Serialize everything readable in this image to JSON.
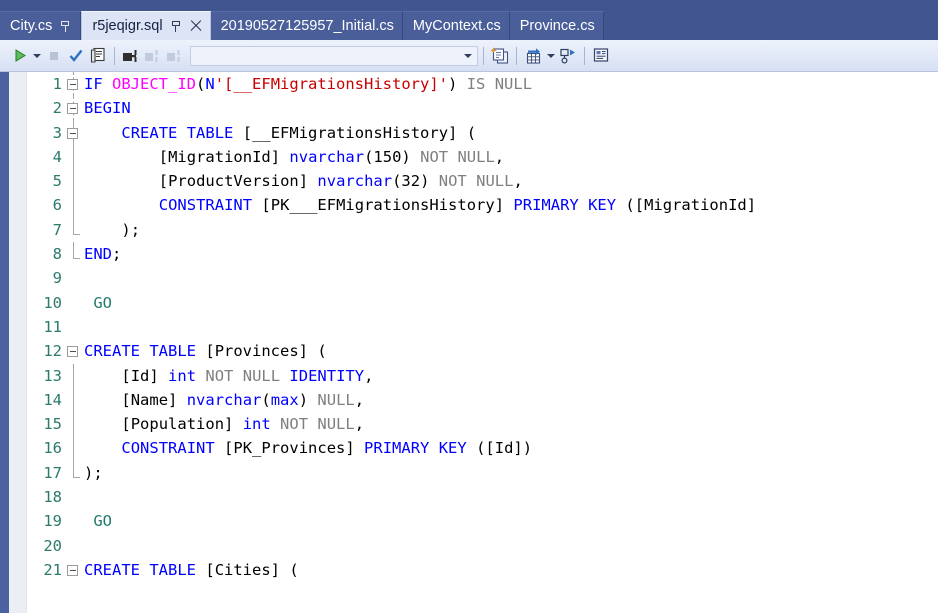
{
  "window": {
    "chrome_color": "#41558f",
    "active_tab_bg": "#dce4f5"
  },
  "tabs": [
    {
      "label": "City.cs",
      "active": false,
      "pin": true,
      "close": false
    },
    {
      "label": "r5jeqigr.sql",
      "active": true,
      "pin": true,
      "close": true
    },
    {
      "label": "20190527125957_Initial.cs",
      "active": false,
      "pin": false,
      "close": false
    },
    {
      "label": "MyContext.cs",
      "active": false,
      "pin": false,
      "close": false
    },
    {
      "label": "Province.cs",
      "active": false,
      "pin": false,
      "close": false
    }
  ],
  "toolbar": {
    "execute_label": "Execute",
    "execute_dropdown_label": "Execute options",
    "stop_label": "Cancel Executing Query",
    "parse_label": "Parse",
    "display_estimated_plan_label": "Display Estimated Execution Plan",
    "connect_label": "Connect",
    "disconnect_label": "Disconnect",
    "change_connection_label": "Change Connection",
    "database_combo_value": "",
    "database_combo_placeholder": "",
    "new_query_label": "New Query with Current Connection",
    "results_to_grid_label": "Results to Grid",
    "results_grid_dropdown_label": "Results options",
    "include_actual_plan_label": "Include Actual Execution Plan",
    "results_to_text_label": "Results to Text"
  },
  "editor": {
    "language": "sql",
    "line_count_visible": 21,
    "colors": {
      "keyword": "#0000ff",
      "function": "#ff00ff",
      "string": "#c80000",
      "operator_gray": "#808080",
      "line_number": "#2b7a6b",
      "go_statement": "#1f7a6b",
      "identifier": "#000000",
      "background": "#ffffff"
    },
    "lines": [
      {
        "n": 1,
        "fold": "open",
        "guide": "dash",
        "text": "IF OBJECT_ID(N'[__EFMigrationsHistory]') IS NULL"
      },
      {
        "n": 2,
        "fold": "open",
        "guide": "dash",
        "text": "BEGIN"
      },
      {
        "n": 3,
        "fold": "open",
        "guide": "line",
        "text": "    CREATE TABLE [__EFMigrationsHistory] ("
      },
      {
        "n": 4,
        "fold": "none",
        "guide": "line",
        "text": "        [MigrationId] nvarchar(150) NOT NULL,"
      },
      {
        "n": 5,
        "fold": "none",
        "guide": "line",
        "text": "        [ProductVersion] nvarchar(32) NOT NULL,"
      },
      {
        "n": 6,
        "fold": "none",
        "guide": "line",
        "text": "        CONSTRAINT [PK___EFMigrationsHistory] PRIMARY KEY ([MigrationId]"
      },
      {
        "n": 7,
        "fold": "none",
        "guide": "foot",
        "text": "    );"
      },
      {
        "n": 8,
        "fold": "none",
        "guide": "foot",
        "text": "END;"
      },
      {
        "n": 9,
        "fold": "none",
        "guide": "none",
        "text": ""
      },
      {
        "n": 10,
        "fold": "none",
        "guide": "none",
        "text": " GO"
      },
      {
        "n": 11,
        "fold": "none",
        "guide": "none",
        "text": ""
      },
      {
        "n": 12,
        "fold": "open",
        "guide": "none",
        "text": "CREATE TABLE [Provinces] ("
      },
      {
        "n": 13,
        "fold": "none",
        "guide": "line",
        "text": "    [Id] int NOT NULL IDENTITY,"
      },
      {
        "n": 14,
        "fold": "none",
        "guide": "line",
        "text": "    [Name] nvarchar(max) NULL,"
      },
      {
        "n": 15,
        "fold": "none",
        "guide": "line",
        "text": "    [Population] int NOT NULL,"
      },
      {
        "n": 16,
        "fold": "none",
        "guide": "line",
        "text": "    CONSTRAINT [PK_Provinces] PRIMARY KEY ([Id])"
      },
      {
        "n": 17,
        "fold": "none",
        "guide": "foot",
        "text": ");"
      },
      {
        "n": 18,
        "fold": "none",
        "guide": "none",
        "text": ""
      },
      {
        "n": 19,
        "fold": "none",
        "guide": "none",
        "text": " GO"
      },
      {
        "n": 20,
        "fold": "none",
        "guide": "none",
        "text": ""
      },
      {
        "n": 21,
        "fold": "open",
        "guide": "none",
        "text": "CREATE TABLE [Cities] ("
      }
    ],
    "tokens": {
      "keywords": [
        "IF",
        "IS",
        "NULL",
        "BEGIN",
        "END",
        "CREATE",
        "TABLE",
        "CONSTRAINT",
        "PRIMARY",
        "KEY",
        "NOT",
        "IDENTITY",
        "nvarchar",
        "int",
        "max",
        "GO"
      ],
      "functions": [
        "OBJECT_ID"
      ],
      "strings": [
        "N'[__EFMigrationsHistory]'"
      ],
      "identifiers": [
        "[__EFMigrationsHistory]",
        "[MigrationId]",
        "[ProductVersion]",
        "[PK___EFMigrationsHistory]",
        "[Provinces]",
        "[Id]",
        "[Name]",
        "[Population]",
        "[PK_Provinces]",
        "[Cities]"
      ],
      "numbers": [
        "150",
        "32"
      ]
    }
  }
}
